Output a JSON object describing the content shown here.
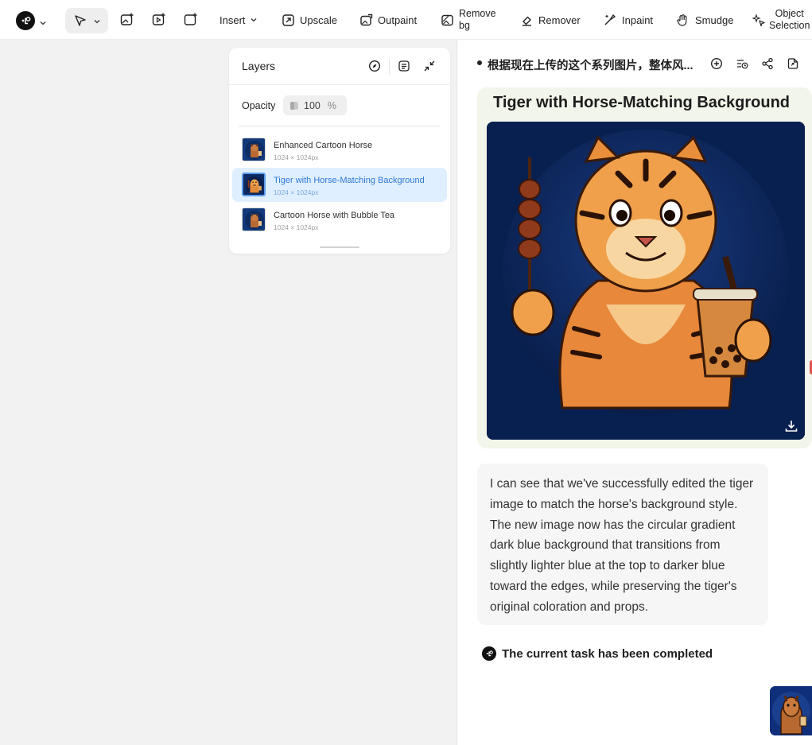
{
  "toolbar": {
    "insert_label": "Insert",
    "upscale_label": "Upscale",
    "outpaint_label": "Outpaint",
    "remove_bg_line1": "Remove",
    "remove_bg_line2": "bg",
    "remover_label": "Remover",
    "inpaint_label": "Inpaint",
    "smudge_label": "Smudge",
    "object_selection_line1": "Object",
    "object_selection_line2": "Selection"
  },
  "layers_panel": {
    "title": "Layers",
    "opacity_label": "Opacity",
    "opacity_value": "100",
    "opacity_unit": "%",
    "items": [
      {
        "name": "Enhanced Cartoon Horse",
        "size": "1024 × 1024px",
        "selected": false
      },
      {
        "name": "Tiger with Horse-Matching Background",
        "size": "1024 × 1024px",
        "selected": true
      },
      {
        "name": "Cartoon Horse with Bubble Tea",
        "size": "1024 × 1024px",
        "selected": false
      }
    ]
  },
  "chat": {
    "title": "根据现在上传的这个系列图片，整体风...",
    "image_card_title": "Tiger with Horse-Matching Background",
    "message": "I can see that we've successfully edited the tiger image to match the horse's background style. The new image now has the circular gradient dark blue background that transitions from slightly lighter blue at the top to darker blue toward the edges, while preserving the tiger's original coloration and props.",
    "status": "The current task has been completed"
  },
  "colors": {
    "canvas_bg": "#f2f2f2",
    "selected_layer_bg": "#dfefff",
    "selected_layer_text": "#2f79d7",
    "card_bg": "#f2f5ea",
    "image_bg": "#0b2355"
  },
  "icons": [
    "logo-icon",
    "cursor-icon",
    "image-edit-icon",
    "video-icon",
    "frame-add-icon",
    "upscale-icon",
    "outpaint-icon",
    "remove-bg-icon",
    "remover-icon",
    "inpaint-icon",
    "smudge-icon",
    "object-selection-icon",
    "compass-icon",
    "list-icon",
    "collapse-icon",
    "add-circle-icon",
    "history-icon",
    "share-icon",
    "export-icon",
    "download-icon"
  ]
}
